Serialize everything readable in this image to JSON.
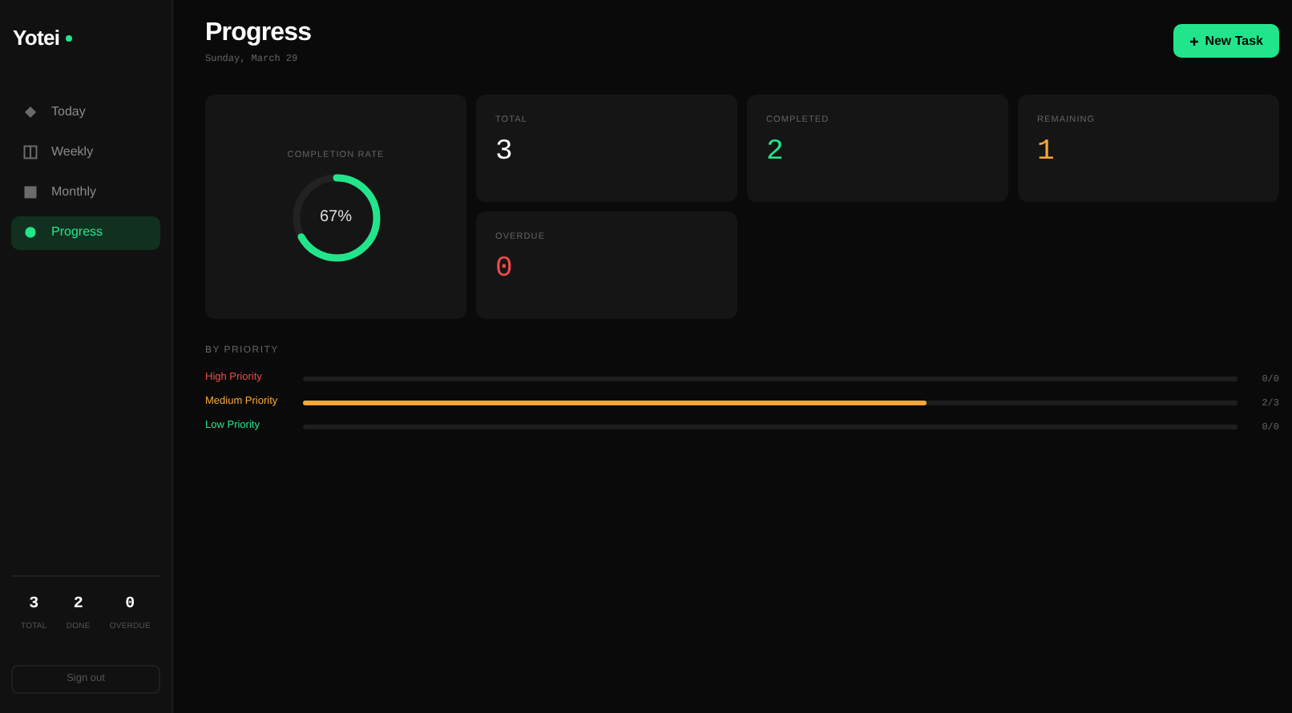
{
  "sidebar": {
    "logo": "Yotei",
    "nav": [
      {
        "label": "Today",
        "selected": false
      },
      {
        "label": "Weekly",
        "selected": false
      },
      {
        "label": "Monthly",
        "selected": false
      },
      {
        "label": "Progress",
        "selected": true
      }
    ],
    "stats": [
      {
        "value": "3",
        "label": "TOTAL"
      },
      {
        "value": "2",
        "label": "DONE"
      },
      {
        "value": "0",
        "label": "OVERDUE"
      }
    ],
    "sign_out": "Sign out"
  },
  "header": {
    "title": "Progress",
    "date": "Sunday, March 29",
    "new_task": "New Task"
  },
  "completion": {
    "label": "COMPLETION RATE",
    "value": "67%",
    "level": 0.67
  },
  "stat_cards": [
    {
      "label": "TOTAL",
      "value": "3",
      "color": "#ffffff"
    },
    {
      "label": "COMPLETED",
      "value": "2",
      "color": "#22e58b"
    },
    {
      "label": "REMAINING",
      "value": "1",
      "color": "#f5a83a"
    },
    {
      "label": "OVERDUE",
      "value": "0",
      "color": "#ef4b4b"
    }
  ],
  "by_priority": {
    "title": "BY PRIORITY",
    "rows": [
      {
        "label": "High Priority",
        "color": "#ef4b4b",
        "level": 0,
        "count": "0/0"
      },
      {
        "label": "Medium Priority",
        "color": "#f5a83a",
        "level": 0.667,
        "count": "2/3"
      },
      {
        "label": "Low Priority",
        "color": "#22e58b",
        "level": 0,
        "count": "0/0"
      }
    ]
  }
}
